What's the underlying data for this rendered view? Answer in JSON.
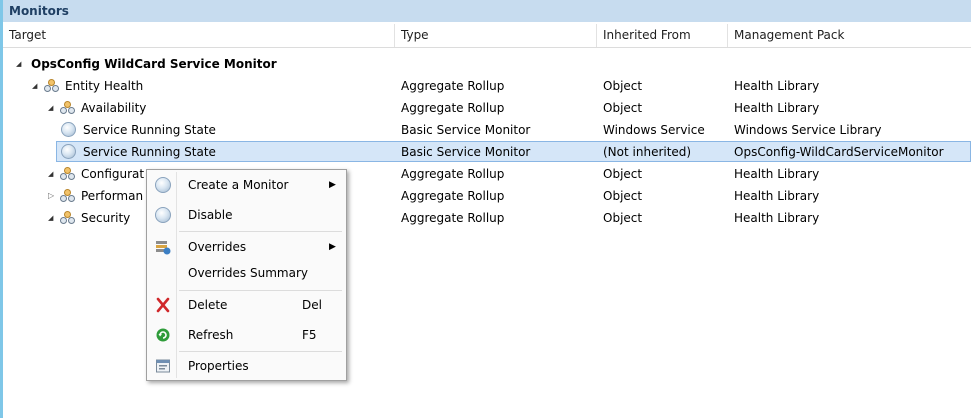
{
  "title": "Monitors",
  "columns": [
    "Target",
    "Type",
    "Inherited From",
    "Management Pack"
  ],
  "rows": [
    {
      "target": "OpsConfig WildCard Service Monitor",
      "type": "",
      "inherited": "",
      "pack": ""
    },
    {
      "target": "Entity Health",
      "type": "Aggregate Rollup",
      "inherited": "Object",
      "pack": "Health Library"
    },
    {
      "target": "Availability",
      "type": "Aggregate Rollup",
      "inherited": "Object",
      "pack": "Health Library"
    },
    {
      "target": "Service Running State",
      "type": "Basic Service Monitor",
      "inherited": "Windows Service",
      "pack": "Windows Service Library"
    },
    {
      "target": "Service Running State",
      "type": "Basic Service Monitor",
      "inherited": "(Not inherited)",
      "pack": "OpsConfig-WildCardServiceMonitor"
    },
    {
      "target": "Configurat",
      "type": "Aggregate Rollup",
      "inherited": "Object",
      "pack": "Health Library"
    },
    {
      "target": "Performan",
      "type": "Aggregate Rollup",
      "inherited": "Object",
      "pack": "Health Library"
    },
    {
      "target": "Security",
      "type": "Aggregate Rollup",
      "inherited": "Object",
      "pack": "Health Library"
    }
  ],
  "context_menu": {
    "items": [
      {
        "label": "Create a Monitor",
        "shortcut": "",
        "icon": "monitor-circle-icon",
        "submenu": true
      },
      {
        "label": "Disable",
        "shortcut": "",
        "icon": "monitor-circle-icon",
        "submenu": false
      },
      {
        "label": "Overrides",
        "shortcut": "",
        "icon": "overrides-icon",
        "submenu": true
      },
      {
        "label": "Overrides Summary",
        "shortcut": "",
        "icon": "",
        "submenu": false
      },
      {
        "label": "Delete",
        "shortcut": "Del",
        "icon": "delete-x-icon",
        "submenu": false
      },
      {
        "label": "Refresh",
        "shortcut": "F5",
        "icon": "refresh-icon",
        "submenu": false
      },
      {
        "label": "Properties",
        "shortcut": "",
        "icon": "properties-icon",
        "submenu": false
      }
    ]
  },
  "colors": {
    "title_bar": "#c7dcef",
    "selection": "#d5e6f8",
    "accent": "#7fc7e8"
  }
}
